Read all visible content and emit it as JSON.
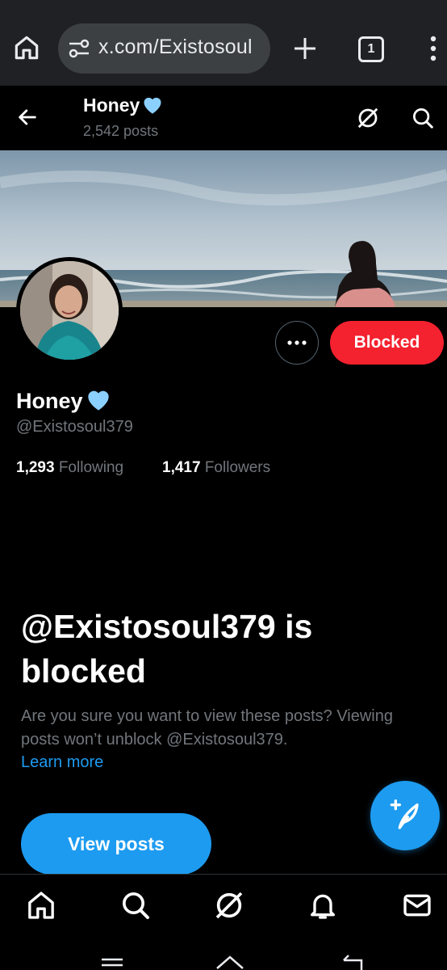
{
  "browser": {
    "url": "x.com/Existosoul",
    "tab_count": "1",
    "icons": [
      "home-icon",
      "site-settings-icon",
      "new-tab-icon",
      "tab-switcher-icon",
      "more-vert-icon"
    ]
  },
  "header": {
    "name": "Honey",
    "posts": "2,542 posts",
    "icons": [
      "back-arrow-icon",
      "grok-icon",
      "search-icon"
    ]
  },
  "profile": {
    "display_name": "Honey",
    "handle": "@Existosoul379",
    "following_count": "1,293",
    "following_label": "Following",
    "followers_count": "1,417",
    "followers_label": "Followers",
    "blocked_button": "Blocked",
    "emoji": "light-blue-heart"
  },
  "blocked_notice": {
    "title": "@Existosoul379 is blocked",
    "description": "Are you sure you want to view these posts? Viewing posts won’t unblock @Existosoul379.",
    "learn_more": "Learn more",
    "view_posts": "View posts"
  },
  "bottom_nav": {
    "items": [
      "home-icon",
      "search-icon",
      "grok-icon",
      "notifications-icon",
      "messages-icon"
    ]
  },
  "colors": {
    "accent": "#1d9bf0",
    "blocked": "#f4212e",
    "heart": "#8cd0ff",
    "muted": "#71767b"
  }
}
